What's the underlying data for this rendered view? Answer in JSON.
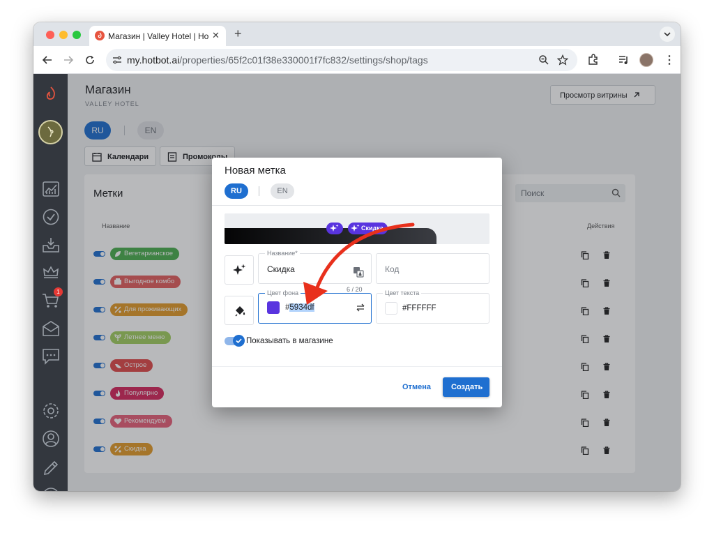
{
  "browser": {
    "tab_title": "Магазин | Valley Hotel | Hotbot",
    "url_host": "my.hotbot.ai",
    "url_path": "/properties/65f2c01f38e330001f7fc832/settings/shop/tags"
  },
  "sidebar": {
    "cart_badge": "1",
    "icons": [
      "flame-logo-icon",
      "avatar",
      "analytics-icon",
      "check-circle-icon",
      "inbox-icon",
      "crown-icon",
      "cart-icon",
      "mail-icon",
      "chat-icon",
      "settings-icon",
      "user-circle-icon",
      "pencil-icon",
      "help-icon"
    ]
  },
  "header": {
    "title": "Магазин",
    "subtitle": "VALLEY HOTEL",
    "storefront_button": "Просмотр витрины",
    "lang_ru": "RU",
    "lang_en": "EN"
  },
  "subtabs": {
    "calendars": "Календари",
    "promo": "Промокоды"
  },
  "tags_card": {
    "title": "Метки",
    "search_placeholder": "Поиск",
    "col_name": "Название",
    "col_actions": "Действия",
    "rows": [
      {
        "label": "Вегетарианское",
        "color": "#4caf50"
      },
      {
        "label": "Выгодное комбо",
        "color": "#e35f5f"
      },
      {
        "label": "Для проживающих",
        "color": "#e39b2a"
      },
      {
        "label": "Летнее меню",
        "color": "#a3cf62"
      },
      {
        "label": "Острое",
        "color": "#e04a4a"
      },
      {
        "label": "Популярно",
        "color": "#d6285d"
      },
      {
        "label": "Рекомендуем",
        "color": "#e8607a"
      },
      {
        "label": "Скидка",
        "color": "#e39b2a"
      }
    ]
  },
  "dialog": {
    "title": "Новая метка",
    "lang_ru": "RU",
    "lang_en": "EN",
    "preview_label": "Скидка",
    "name_label": "Название*",
    "name_value": "Скидка",
    "name_counter": "6 / 20",
    "code_placeholder": "Код",
    "bg_label": "Цвет фона",
    "bg_value": "#5934df",
    "bg_prefix": "#",
    "bg_selected": "5934df",
    "text_label": "Цвет текста",
    "text_value": "#FFFFFF",
    "show_in_shop": "Показывать в магазине",
    "cancel": "Отмена",
    "create": "Создать"
  },
  "colors": {
    "accent": "#1f6fd0",
    "tag_bg": "#5934df",
    "annotation_arrow": "#e8301c"
  }
}
